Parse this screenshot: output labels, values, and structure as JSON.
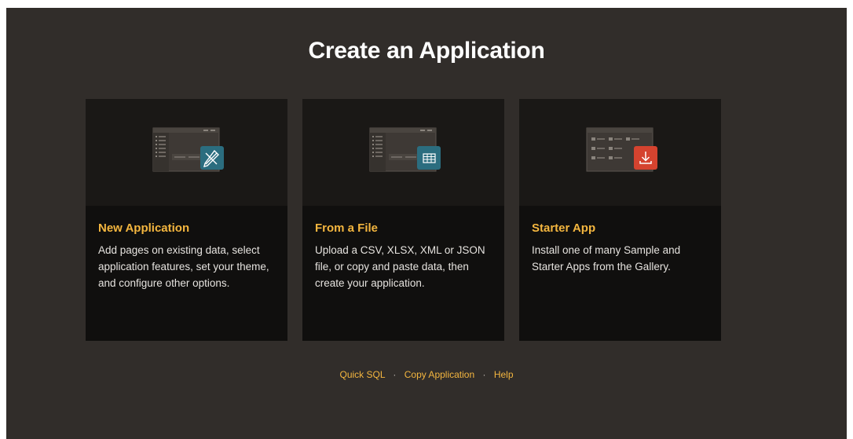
{
  "page": {
    "title": "Create an Application"
  },
  "cards": [
    {
      "title": "New Application",
      "description": "Add pages on existing data, select application features, set your theme, and configure other options.",
      "icon": "pencil-ruler-icon",
      "badge_color": "#2b6d7f"
    },
    {
      "title": "From a File",
      "description": "Upload a CSV, XLSX, XML or JSON file, or copy and paste data, then create your application.",
      "icon": "table-grid-icon",
      "badge_color": "#2b6d7f"
    },
    {
      "title": "Starter App",
      "description": "Install one of many Sample and Starter Apps from the Gallery.",
      "icon": "download-icon",
      "badge_color": "#d5432f"
    }
  ],
  "footer": {
    "links": [
      "Quick SQL",
      "Copy Application",
      "Help"
    ],
    "separator": "·"
  },
  "colors": {
    "background": "#312d2a",
    "card": "#100f0e",
    "accent": "#f4b63f"
  }
}
